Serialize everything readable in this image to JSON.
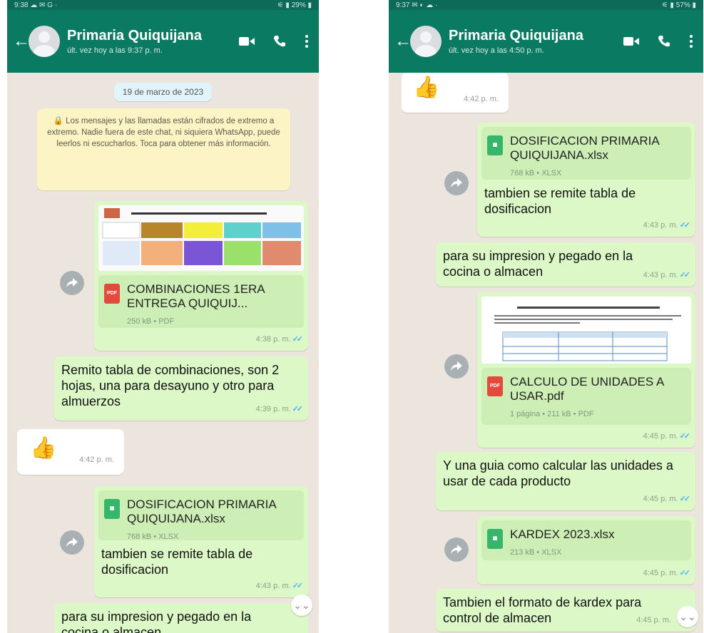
{
  "left": {
    "status": {
      "time": "9:38 ☁ ✉ G ·",
      "right": "⚟ ▮ 29% ▮"
    },
    "contact": {
      "name": "Primaria Quiquijana",
      "last_seen": "últ. vez hoy a las 9:37 p. m."
    },
    "date_chip": "19 de marzo de 2023",
    "encryption_notice": "🔒 Los mensajes y las llamadas están cifrados de extremo a extremo. Nadie fuera de este chat, ni siquiera WhatsApp, puede leerlos ni escucharlos. Toca para obtener más información.",
    "msg_pdf": {
      "name": "COMBINACIONES 1ERA ENTREGA QUIQUIJ...",
      "meta": "250 kB • PDF",
      "time": "4:38 p. m."
    },
    "msg_text1": {
      "text": "Remito tabla de combinaciones, son 2 hojas, una para desayuno y otro para almuerzos",
      "time": "4:39 p. m."
    },
    "msg_like": {
      "emoji": "👍",
      "time": "4:42 p. m."
    },
    "msg_xlsx": {
      "name": "DOSIFICACION PRIMARIA QUIQUIJANA.xlsx",
      "meta": "768 kB • XLSX",
      "caption": "tambien se remite tabla de dosificacion",
      "time": "4:43 p. m."
    },
    "msg_partial": {
      "text": "para su impresion y pegado en la cocina o almacen"
    }
  },
  "right": {
    "status": {
      "time": "9:37 ✉ ◐ ☁ ·",
      "right": "⚟ ▮ 57% ▮"
    },
    "contact": {
      "name": "Primaria Quiquijana",
      "last_seen": "últ. vez hoy a las 4:50 p. m."
    },
    "msg_like": {
      "emoji": "👍",
      "time": "4:42 p. m."
    },
    "msg_xlsx": {
      "name": "DOSIFICACION PRIMARIA QUIQUIJANA.xlsx",
      "meta": "768 kB • XLSX",
      "caption": "tambien se remite tabla de dosificacion",
      "time": "4:43 p. m."
    },
    "msg_text1": {
      "text": "para su impresion y pegado en la cocina o almacen",
      "time": "4:43 p. m."
    },
    "msg_pdf": {
      "name": "CALCULO DE UNIDADES A USAR.pdf",
      "meta": "1 página • 211 kB • PDF",
      "time": "4:45 p. m."
    },
    "msg_text2": {
      "text": "Y una guia como calcular las unidades a usar de cada producto",
      "time": "4:45 p. m."
    },
    "msg_kardex": {
      "name": "KARDEX  2023.xlsx",
      "meta": "213 kB • XLSX",
      "time": "4:45 p. m."
    },
    "msg_text3": {
      "text": "Tambien el formato de kardex para control de almacen",
      "time": "4:45 p. m."
    }
  },
  "icons": {
    "back": "arrow-left-icon",
    "video": "video-call-icon",
    "call": "phone-icon",
    "menu": "more-vert-icon",
    "forward": "forward-share-icon"
  },
  "colors": {
    "header": "#0a7a63",
    "outgoing": "#dcf8c6",
    "incoming": "#ffffff",
    "chat_bg": "#ece5dd",
    "read_ticks": "#4fb3f6"
  }
}
